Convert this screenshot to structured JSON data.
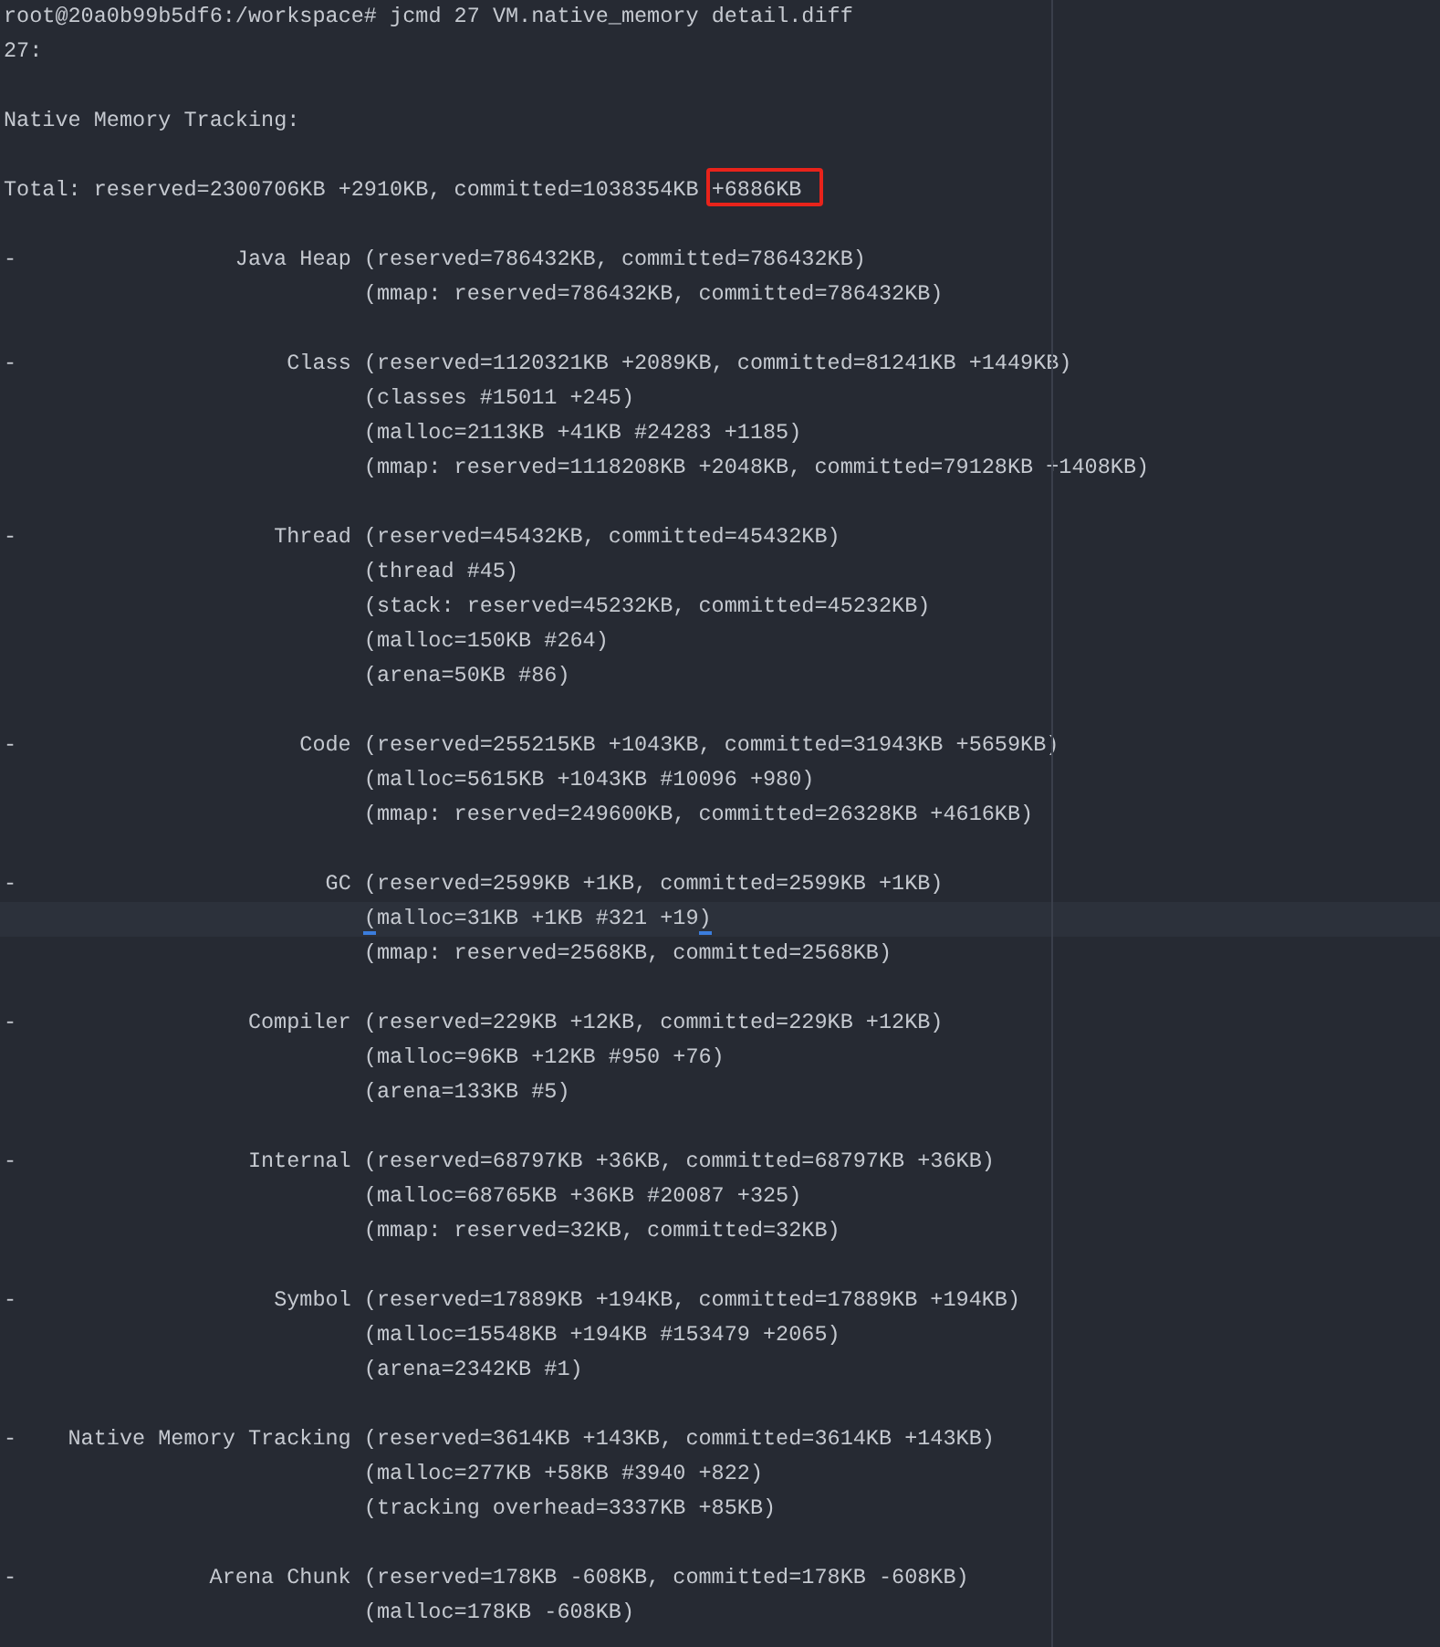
{
  "command": "root@20a0b99b5df6:/workspace# jcmd 27 VM.native_memory detail.diff",
  "pid": "27:",
  "header": "Native Memory Tracking:",
  "total": {
    "text": "Total: reserved=2300706KB +2910KB, committed=1038354KB",
    "highlighted": "+6886KB"
  },
  "categories": [
    {
      "marker": "-",
      "name": "Java Heap",
      "lines": [
        {
          "text": "(reserved=786432KB, committed=786432KB)",
          "current": false
        },
        {
          "text": "(mmap: reserved=786432KB, committed=786432KB)",
          "current": false
        }
      ]
    },
    {
      "marker": "-",
      "name": "Class",
      "lines": [
        {
          "text": "(reserved=1120321KB +2089KB, committed=81241KB +1449KB)",
          "current": false
        },
        {
          "text": "(classes #15011 +245)",
          "current": false
        },
        {
          "text": "(malloc=2113KB +41KB #24283 +1185)",
          "current": false
        },
        {
          "text": "(mmap: reserved=1118208KB +2048KB, committed=79128KB +1408KB)",
          "current": false
        }
      ]
    },
    {
      "marker": "-",
      "name": "Thread",
      "lines": [
        {
          "text": "(reserved=45432KB, committed=45432KB)",
          "current": false
        },
        {
          "text": "(thread #45)",
          "current": false
        },
        {
          "text": "(stack: reserved=45232KB, committed=45232KB)",
          "current": false
        },
        {
          "text": "(malloc=150KB #264)",
          "current": false
        },
        {
          "text": "(arena=50KB #86)",
          "current": false
        }
      ]
    },
    {
      "marker": "-",
      "name": "Code",
      "lines": [
        {
          "text": "(reserved=255215KB +1043KB, committed=31943KB +5659KB)",
          "current": false
        },
        {
          "text": "(malloc=5615KB +1043KB #10096 +980)",
          "current": false
        },
        {
          "text": "(mmap: reserved=249600KB, committed=26328KB +4616KB)",
          "current": false
        }
      ]
    },
    {
      "marker": "-",
      "name": "GC",
      "lines": [
        {
          "text": "(reserved=2599KB +1KB, committed=2599KB +1KB)",
          "current": false
        },
        {
          "text": "(malloc=31KB +1KB #321 +19)",
          "current": true
        },
        {
          "text": "(mmap: reserved=2568KB, committed=2568KB)",
          "current": false
        }
      ]
    },
    {
      "marker": "-",
      "name": "Compiler",
      "lines": [
        {
          "text": "(reserved=229KB +12KB, committed=229KB +12KB)",
          "current": false
        },
        {
          "text": "(malloc=96KB +12KB #950 +76)",
          "current": false
        },
        {
          "text": "(arena=133KB #5)",
          "current": false
        }
      ]
    },
    {
      "marker": "-",
      "name": "Internal",
      "lines": [
        {
          "text": "(reserved=68797KB +36KB, committed=68797KB +36KB)",
          "current": false
        },
        {
          "text": "(malloc=68765KB +36KB #20087 +325)",
          "current": false
        },
        {
          "text": "(mmap: reserved=32KB, committed=32KB)",
          "current": false
        }
      ]
    },
    {
      "marker": "-",
      "name": "Symbol",
      "lines": [
        {
          "text": "(reserved=17889KB +194KB, committed=17889KB +194KB)",
          "current": false
        },
        {
          "text": "(malloc=15548KB +194KB #153479 +2065)",
          "current": false
        },
        {
          "text": "(arena=2342KB #1)",
          "current": false
        }
      ]
    },
    {
      "marker": "-",
      "name": "Native Memory Tracking",
      "lines": [
        {
          "text": "(reserved=3614KB +143KB, committed=3614KB +143KB)",
          "current": false
        },
        {
          "text": "(malloc=277KB +58KB #3940 +822)",
          "current": false
        },
        {
          "text": "(tracking overhead=3337KB +85KB)",
          "current": false
        }
      ]
    },
    {
      "marker": "-",
      "name": "Arena Chunk",
      "lines": [
        {
          "text": "(reserved=178KB -608KB, committed=178KB -608KB)",
          "current": false
        },
        {
          "text": "(malloc=178KB -608KB)",
          "current": false
        }
      ]
    }
  ]
}
